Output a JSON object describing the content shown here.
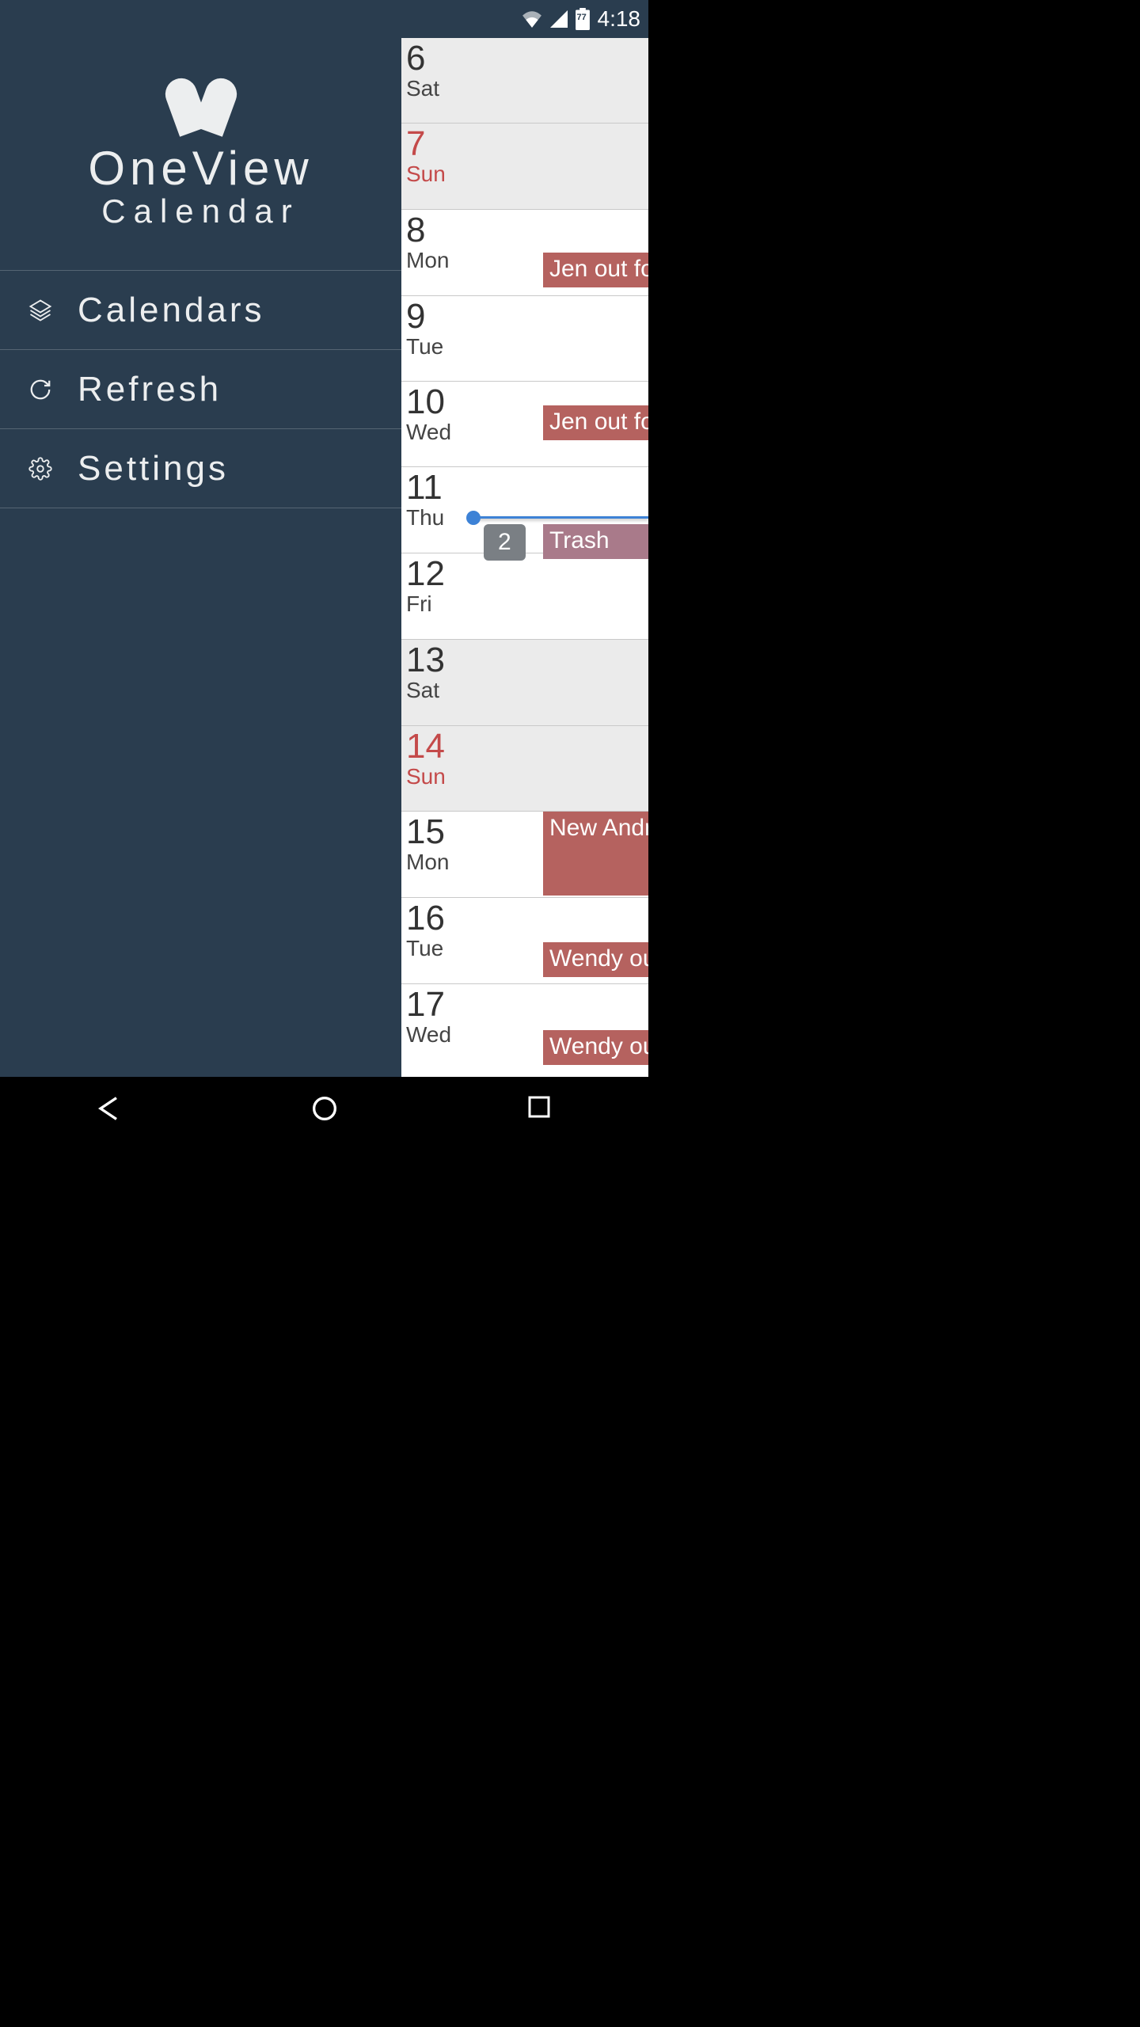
{
  "status": {
    "battery": "77",
    "time": "4:18"
  },
  "app": {
    "logo_line1": "OneView",
    "logo_line2": "Calendar"
  },
  "menu": {
    "calendars": "Calendars",
    "refresh": "Refresh",
    "settings": "Settings"
  },
  "days": [
    {
      "num": "6",
      "name": "Sat"
    },
    {
      "num": "7",
      "name": "Sun"
    },
    {
      "num": "8",
      "name": "Mon"
    },
    {
      "num": "9",
      "name": "Tue"
    },
    {
      "num": "10",
      "name": "Wed"
    },
    {
      "num": "11",
      "name": "Thu"
    },
    {
      "num": "12",
      "name": "Fri"
    },
    {
      "num": "13",
      "name": "Sat"
    },
    {
      "num": "14",
      "name": "Sun"
    },
    {
      "num": "15",
      "name": "Mon"
    },
    {
      "num": "16",
      "name": "Tue"
    },
    {
      "num": "17",
      "name": "Wed"
    }
  ],
  "events": {
    "d8": "Jen out fo",
    "d10": "Jen out fo",
    "d11_badge": "2",
    "d11_trash": "Trash",
    "d15": "New Andr",
    "d16": "Wendy ou",
    "d17": "Wendy ou"
  }
}
